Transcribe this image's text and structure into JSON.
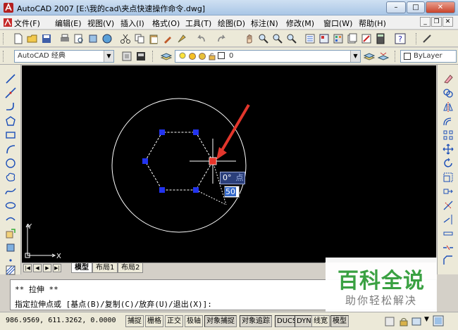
{
  "titlebar": {
    "app": "AutoCAD 2007",
    "file": "[E:\\我的cad\\夹点快速操作命令.dwg]",
    "min": "–",
    "max": "□",
    "close": "✕"
  },
  "menu": {
    "items": [
      "文件(F)",
      "编辑(E)",
      "视图(V)",
      "插入(I)",
      "格式(O)",
      "工具(T)",
      "绘图(D)",
      "标注(N)",
      "修改(M)",
      "窗口(W)",
      "帮助(H)"
    ],
    "doc_min": "_",
    "doc_restore": "❐",
    "doc_close": "✕"
  },
  "toolbar2": {
    "workspace": "AutoCAD 经典",
    "layer": "0",
    "linetype": "ByLayer"
  },
  "canvas": {
    "ucs_y": "Y",
    "ucs_x": "X",
    "dyn_angle": "0°",
    "dyn_hint": "点",
    "dyn_value": "50"
  },
  "tabs": {
    "items": [
      "模型",
      "布局1",
      "布局2"
    ],
    "active": "模型"
  },
  "command": {
    "line1": "** 拉伸 **",
    "line2": "指定拉伸点或 [基点(B)/复制(C)/放弃(U)/退出(X)]:"
  },
  "status": {
    "coords": "986.9569,  611.3262, 0.0000",
    "buttons": [
      "捕捉",
      "栅格",
      "正交",
      "极轴",
      "对象捕捉",
      "对象追踪",
      "DUCS",
      "DYN",
      "线宽",
      "模型"
    ],
    "on_buttons": [
      "对象捕捉",
      "对象追踪",
      "DUCS",
      "DYN",
      "模型"
    ]
  },
  "watermark": {
    "title": "百科全说",
    "subtitle": "助你轻松解决"
  },
  "colors": {
    "canvas_bg": "#000000",
    "grip_blue": "#2233ee",
    "grip_hot": "#e8352a",
    "arrow": "#e2362c",
    "watermark_green": "#3aa142"
  }
}
